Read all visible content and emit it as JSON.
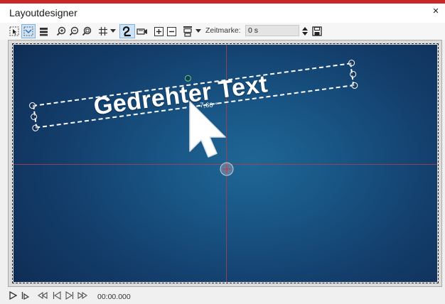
{
  "window": {
    "title": "Layoutdesigner",
    "close_glyph": "×"
  },
  "toolbar": {
    "buttons": [
      "select-icon",
      "marquee-select-icon",
      "grid-lines-icon",
      "zoom-in-icon",
      "zoom-out-icon",
      "zoom-fit-icon",
      "grid-icon",
      "grid-dropdown-icon",
      "path-tool-icon",
      "camera-icon",
      "add-object-icon",
      "remove-object-icon",
      "align-icon",
      "align-dropdown-icon"
    ],
    "zeitmarke_label": "Zeitmarke:",
    "zeitmarke_value": "0 s",
    "stepper_icon": "stepper-icon",
    "save_icon": "save-icon"
  },
  "canvas": {
    "text_object": "Gedrehter Text",
    "rotation_label": "-7,60 °",
    "background_colors": [
      "#1f6795",
      "#133d6a",
      "#0f2d55"
    ],
    "guide_color": "#af3c50",
    "rotation_handle_color": "#6dd46d"
  },
  "playback": {
    "buttons": [
      "play-icon",
      "play-from-icon",
      "rewind-icon",
      "step-back-icon",
      "step-forward-icon",
      "fast-forward-icon"
    ],
    "time": "00:00.000"
  }
}
